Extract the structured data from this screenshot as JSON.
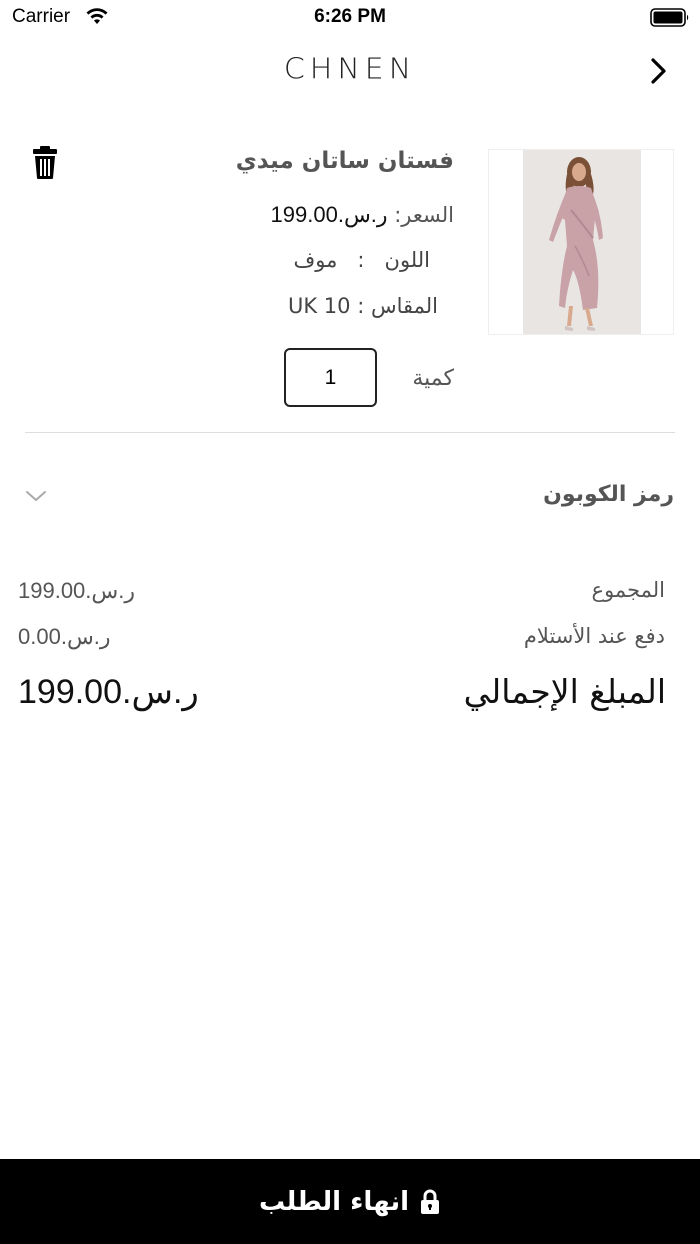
{
  "status_bar": {
    "carrier": "Carrier",
    "time": "6:26 PM"
  },
  "nav": {
    "brand": "CHNEN",
    "back_icon": "chevron-right-icon"
  },
  "cart_item": {
    "name": "فستان ساتان ميدي",
    "price_label": "السعر:",
    "price_value": "ر.س.199.00",
    "color_label": "اللون",
    "color_separator": ":",
    "color_value": "موف",
    "size_label": "المقاس",
    "size_separator": ":",
    "size_value": "UK 10",
    "quantity_label": "كمية",
    "quantity_value": "1",
    "delete_icon": "trash-icon"
  },
  "coupon": {
    "label": "رمز الكوبون",
    "icon": "chevron-down-icon"
  },
  "summary": {
    "subtotal_label": "المجموع",
    "subtotal_value": "ر.س.199.00",
    "cod_label": "دفع عند الأستلام",
    "cod_value": "ر.س.0.00",
    "total_label": "المبلغ الإجمالي",
    "total_value": "ر.س.199.00"
  },
  "checkout": {
    "label": "انهاء الطلب",
    "icon": "lock-icon"
  },
  "colors": {
    "checkout_bg": "#000000",
    "divider": "#dddddd",
    "text_muted": "#555555"
  }
}
